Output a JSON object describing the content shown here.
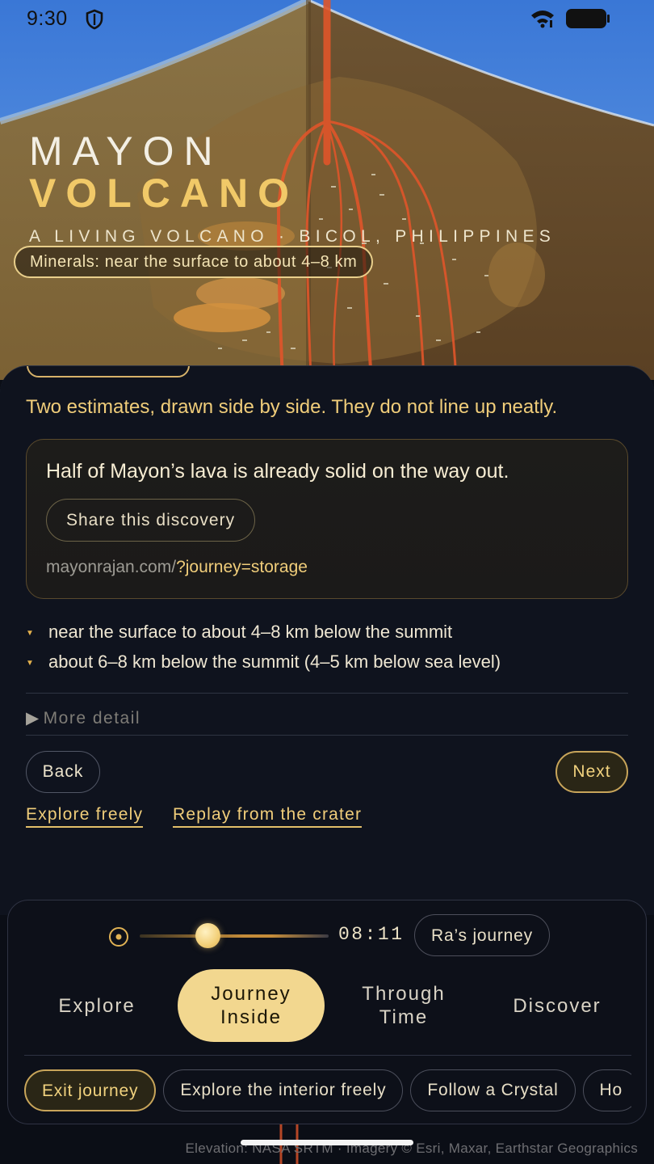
{
  "status_bar": {
    "time": "9:30"
  },
  "hero": {
    "title_line1": "MAYON",
    "title_line2": "VOLCANO",
    "subtitle": "A LIVING VOLCANO · BICOL, PHILIPPINES",
    "mineral_chip": "Minerals: near the surface to about 4–8 km"
  },
  "panel": {
    "intro": "Two estimates, drawn side by side. They do not line up neatly.",
    "card": {
      "title": "Half of Mayon’s lava is already solid on the way out.",
      "share_label": "Share this discovery",
      "link_base": "mayonrajan.com/",
      "link_query": "?journey=storage"
    },
    "facts": [
      "near the surface to about 4–8 km below the summit",
      "about 6–8 km below the summit (4–5 km below sea level)"
    ],
    "more_detail": "More detail",
    "back_label": "Back",
    "next_label": "Next",
    "explore_link": "Explore freely",
    "replay_link": "Replay from the crater"
  },
  "dock": {
    "timeline_time": "08:11",
    "timeline_progress": 0.36,
    "journey_button": "Ra’s journey",
    "modes": [
      {
        "label": "Explore",
        "active": false
      },
      {
        "label": "Journey\nInside",
        "active": true
      },
      {
        "label": "Through\nTime",
        "active": false
      },
      {
        "label": "Discover",
        "active": false
      }
    ],
    "chips": [
      {
        "label": "Exit journey",
        "active": true
      },
      {
        "label": "Explore the interior freely",
        "active": false
      },
      {
        "label": "Follow a Crystal",
        "active": false
      },
      {
        "label": "Ho",
        "active": false
      }
    ]
  },
  "attribution": "Elevation: NASA SRTM · Imagery © Esri, Maxar, Earthstar Geographics",
  "colors": {
    "accent_gold": "#f0cd7a",
    "active_tab_bg": "#f2d78f",
    "panel_bg": "#0f131e",
    "lava": "#e0552a"
  }
}
